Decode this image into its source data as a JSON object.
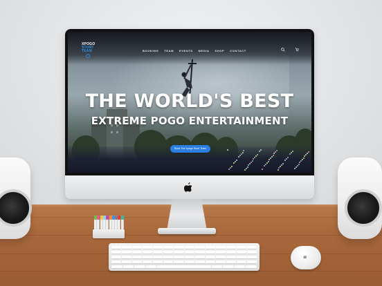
{
  "website": {
    "logo": {
      "line1": "XPOGO",
      "line2": "STUNT",
      "line3": "TEAM"
    },
    "nav": [
      {
        "label": "BOOKING"
      },
      {
        "label": "TEAM"
      },
      {
        "label": "EVENTS"
      },
      {
        "label": "MEDIA"
      },
      {
        "label": "SHOP"
      },
      {
        "label": "CONTACT"
      }
    ],
    "nav_icons": [
      "search-icon",
      "cart-icon"
    ],
    "hero": {
      "title": "THE WORLD'S BEST",
      "subtitle": "EXTREME POGO ENTERTAINMENT",
      "cta_label": "Book The Xpogo Stunt Team"
    },
    "colors": {
      "accent": "#2a7fe0",
      "text": "#ffffff"
    }
  },
  "scene": {
    "marker_colors": [
      "#6dbf4a",
      "#e85a8a",
      "#f2c640",
      "#8fd0e8",
      "#c14ab0",
      "#f28a3a",
      "#4a8de0",
      "#7f7f7f",
      "#e03c3c",
      "#3cb89a"
    ]
  }
}
